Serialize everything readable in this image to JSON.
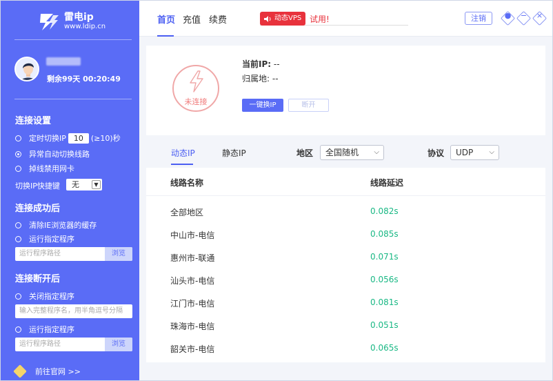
{
  "sidebar": {
    "logo_name": "雷电ip",
    "logo_url": "www.ldip.cn",
    "remaining": "剩余99天 00:20:49",
    "connect_settings": {
      "title": "连接设置",
      "timer_prefix": "定时切换IP",
      "timer_value": "10",
      "timer_suffix": "(≥10)秒",
      "auto_switch": "异常自动切换线路",
      "disable_nic": "掉线禁用网卡",
      "hotkey_label": "切换IP快捷键",
      "hotkey_value": "无"
    },
    "on_success": {
      "title": "连接成功后",
      "clear_cache": "清除IE浏览器的缓存",
      "run_program": "运行指定程序",
      "path_placeholder": "运行程序路径",
      "browse": "浏览"
    },
    "on_disconnect": {
      "title": "连接断开后",
      "close_program": "关闭指定程序",
      "close_placeholder": "输入完整程序名，用半角逗号分隔",
      "run_program": "运行指定程序",
      "path_placeholder": "运行程序路径",
      "browse": "浏览"
    },
    "footer_link": "前往官网 >>"
  },
  "header": {
    "tabs": [
      "首页",
      "充值",
      "续费"
    ],
    "notice_badge": "动态VPS",
    "notice_text": "试用!",
    "logout": "注销"
  },
  "status": {
    "state": "未连接",
    "current_ip_label": "当前IP:",
    "current_ip_value": "--",
    "location_label": "归属地:",
    "location_value": "--",
    "switch_button": "一键换IP",
    "disconnect_button": "断开"
  },
  "filter": {
    "tabs": [
      "动态IP",
      "静态IP"
    ],
    "region_label": "地区",
    "region_value": "全国随机",
    "protocol_label": "协议",
    "protocol_value": "UDP"
  },
  "table": {
    "columns": [
      "线路名称",
      "线路延迟"
    ],
    "rows": [
      {
        "name": "全部地区",
        "latency": "0.082s"
      },
      {
        "name": "中山市-电信",
        "latency": "0.085s"
      },
      {
        "name": "惠州市-联通",
        "latency": "0.071s"
      },
      {
        "name": "汕头市-电信",
        "latency": "0.056s"
      },
      {
        "name": "江门市-电信",
        "latency": "0.081s"
      },
      {
        "name": "珠海市-电信",
        "latency": "0.051s"
      },
      {
        "name": "韶关市-电信",
        "latency": "0.065s"
      }
    ]
  },
  "colors": {
    "accent": "#5a6cf6",
    "danger": "#e8323c",
    "latency": "#19b884"
  }
}
